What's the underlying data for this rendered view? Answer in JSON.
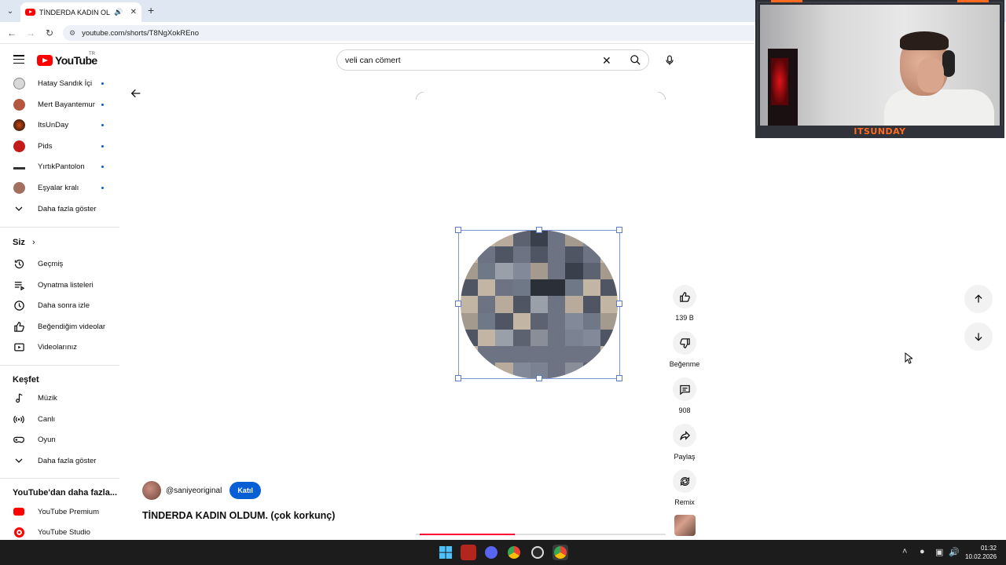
{
  "browser": {
    "tab_title": "TİNDERDA KADIN OLDUM.",
    "url": "youtube.com/shorts/T8NgXokREno"
  },
  "header": {
    "logo_text": "YouTube",
    "country_code": "TR",
    "search_value": "veli can cömert"
  },
  "sidebar": {
    "subscriptions": [
      {
        "label": "Hatay Sandık İçi"
      },
      {
        "label": "Mert Bayantemur"
      },
      {
        "label": "ItsUnDay"
      },
      {
        "label": "Pids"
      },
      {
        "label": "YırtıkPantolon"
      },
      {
        "label": "Eşyalar kralı"
      }
    ],
    "show_more_1": "Daha fazla göster",
    "you_header": "Siz",
    "you_items": [
      {
        "label": "Geçmiş"
      },
      {
        "label": "Oynatma listeleri"
      },
      {
        "label": "Daha sonra izle"
      },
      {
        "label": "Beğendiğim videolar"
      },
      {
        "label": "Videolarınız"
      }
    ],
    "explore_header": "Keşfet",
    "explore_items": [
      {
        "label": "Müzik"
      },
      {
        "label": "Canlı"
      },
      {
        "label": "Oyun"
      }
    ],
    "show_more_2": "Daha fazla göster",
    "more_header": "YouTube'dan daha fazla...",
    "more_items": [
      {
        "label": "YouTube Premium"
      },
      {
        "label": "YouTube Studio"
      }
    ]
  },
  "short": {
    "channel": "@saniyeoriginal",
    "join_label": "Katıl",
    "title": "TİNDERDA KADIN OLDUM. (çok korkunç)",
    "progress": 0.38,
    "actions": {
      "likes": "139 B",
      "dislike": "Beğenme",
      "comments": "908",
      "share": "Paylaş",
      "remix": "Remix"
    }
  },
  "webcam": {
    "label": "ITSUNDAY"
  },
  "taskbar": {
    "time": "01:32",
    "date": "10.02.2026"
  },
  "colors": {
    "accent": "#ff0000",
    "join": "#065fd4",
    "progress": "#ff0033",
    "cam_label": "#ff6a1f"
  }
}
